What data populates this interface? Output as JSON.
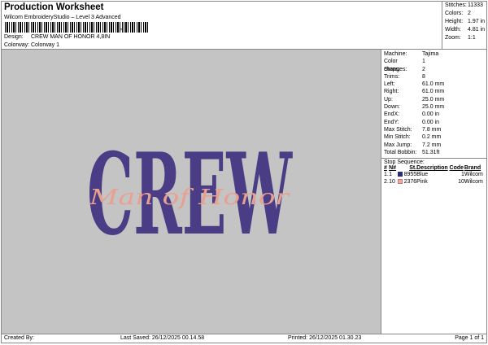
{
  "header": {
    "title": "Production Worksheet",
    "subtitle": "Wilcom EmbroideryStudio – Level 3 Advanced",
    "barcode_suffix": ",",
    "design_label": "Design:",
    "design_value": "CREW MAN OF HONOR 4,8IN",
    "colorway_label": "Colorway:",
    "colorway_value": "Colorway 1"
  },
  "stats": [
    {
      "label": "Stitches:",
      "value": "11333"
    },
    {
      "label": "Colors:",
      "value": "2"
    },
    {
      "label": "Height:",
      "value": "1.97 in"
    },
    {
      "label": "Width:",
      "value": "4.81 in"
    },
    {
      "label": "Zoom:",
      "value": "1:1"
    }
  ],
  "details": [
    {
      "label": "Machine:",
      "value": "Tajima"
    },
    {
      "label": "Color changes:",
      "value": "1"
    },
    {
      "label": "Stops:",
      "value": "2"
    },
    {
      "label": "Trims:",
      "value": "8"
    },
    {
      "label": "Left:",
      "value": "61.0 mm"
    },
    {
      "label": "Right:",
      "value": "61.0 mm"
    },
    {
      "label": "Up:",
      "value": "25.0 mm"
    },
    {
      "label": "Down:",
      "value": "25.0 mm"
    },
    {
      "label": "EndX:",
      "value": "0.00 in"
    },
    {
      "label": "EndY:",
      "value": "0.00 in"
    },
    {
      "label": "Max Stitch:",
      "value": "7.8 mm"
    },
    {
      "label": "Min Stitch:",
      "value": "0.2 mm"
    },
    {
      "label": "Max Jump:",
      "value": "7.2 mm"
    },
    {
      "label": "Total Bobbin:",
      "value": "51.31ft"
    }
  ],
  "stop_sequence": {
    "title": "Stop Sequence:",
    "headers": [
      "#",
      "N#",
      "St.",
      "Description",
      "Code",
      "Brand"
    ],
    "rows": [
      {
        "num": "1.",
        "n": "1",
        "color": "#2e2a7a",
        "st": "8955",
        "desc": "Blue",
        "code": "1",
        "brand": "Wilcom"
      },
      {
        "num": "2.",
        "n": "10",
        "color": "#f0a8a0",
        "st": "2376",
        "desc": "Pink",
        "code": "10",
        "brand": "Wilcom"
      }
    ]
  },
  "design": {
    "main_text": "CREW",
    "script_text": "Man of Honor",
    "main_color": "#4a3d85",
    "script_color": "#e8a090",
    "background": "#c4c4c4"
  },
  "footer": {
    "created_by": "Created By:",
    "last_saved": "Last Saved: 26/12/2025 00.14.58",
    "printed": "Printed: 26/12/2025 01.30.23",
    "page": "Page 1 of 1"
  }
}
